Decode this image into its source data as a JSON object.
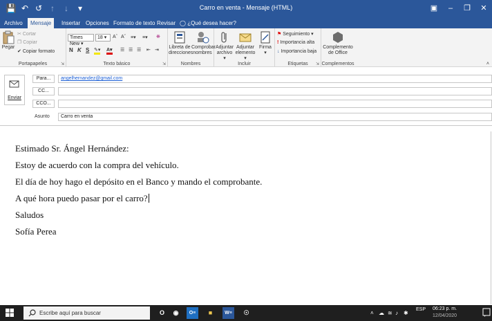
{
  "window": {
    "title": "Carro en venta - Mensaje (HTML)",
    "quick_access": [
      "save",
      "undo",
      "redo",
      "up",
      "down",
      "customize"
    ]
  },
  "tabs": [
    {
      "label": "Archivo",
      "active": false
    },
    {
      "label": "Mensaje",
      "active": true
    },
    {
      "label": "Insertar",
      "active": false
    },
    {
      "label": "Opciones",
      "active": false
    },
    {
      "label": "Formato de texto",
      "active": false
    },
    {
      "label": "Revisar",
      "active": false
    }
  ],
  "tell_me": "¿Qué desea hacer?",
  "ribbon": {
    "clipboard": {
      "paste": "Pegar",
      "cut": "Cortar",
      "copy": "Copiar",
      "format_painter": "Copiar formato",
      "group": "Portapapeles"
    },
    "basic_text": {
      "font": "Times New",
      "size": "18",
      "bold": "N",
      "italic": "K",
      "underline": "S",
      "group": "Texto básico"
    },
    "names": {
      "address_book": "Libreta de direcciones",
      "address_book_l1": "Libreta de",
      "address_book_l2": "direcciones",
      "check_names_l1": "Comprobar",
      "check_names_l2": "nombres",
      "group": "Nombres"
    },
    "include": {
      "attach_file_l1": "Adjuntar",
      "attach_file_l2": "archivo ▾",
      "attach_item_l1": "Adjuntar",
      "attach_item_l2": "elemento ▾",
      "signature_l1": "Firma",
      "signature_l2": "▾",
      "group": "Incluir"
    },
    "tags": {
      "follow_up": "Seguimiento ▾",
      "high": "Importancia alta",
      "low": "Importancia baja",
      "group": "Etiquetas"
    },
    "addins": {
      "office_addins_l1": "Complemento",
      "office_addins_l2": "de Office",
      "group": "Complementos"
    }
  },
  "header": {
    "send": "Enviar",
    "to_button": "Para...",
    "cc_button": "CC...",
    "bcc_button": "CCO...",
    "to_value": "angelhernandez@gmail.com",
    "cc_value": "",
    "bcc_value": "",
    "subject_label": "Asunto",
    "subject_value": "Carro en venta"
  },
  "body": {
    "lines": [
      "Estimado Sr. Ángel Hernández:",
      "Estoy de acuerdo con la compra del vehículo.",
      "El día de hoy hago el depósito en el Banco y mando el comprobante.",
      "A qué hora puedo pasar por el carro?",
      "Saludos",
      "Sofía Perea"
    ]
  },
  "taskbar": {
    "search_placeholder": "Escribe aquí para buscar",
    "language": "ESP",
    "time": "06:23 p. m.",
    "date": "12/04/2020"
  },
  "colors": {
    "accent": "#2b579a",
    "taskbar": "#1f1f1f"
  }
}
